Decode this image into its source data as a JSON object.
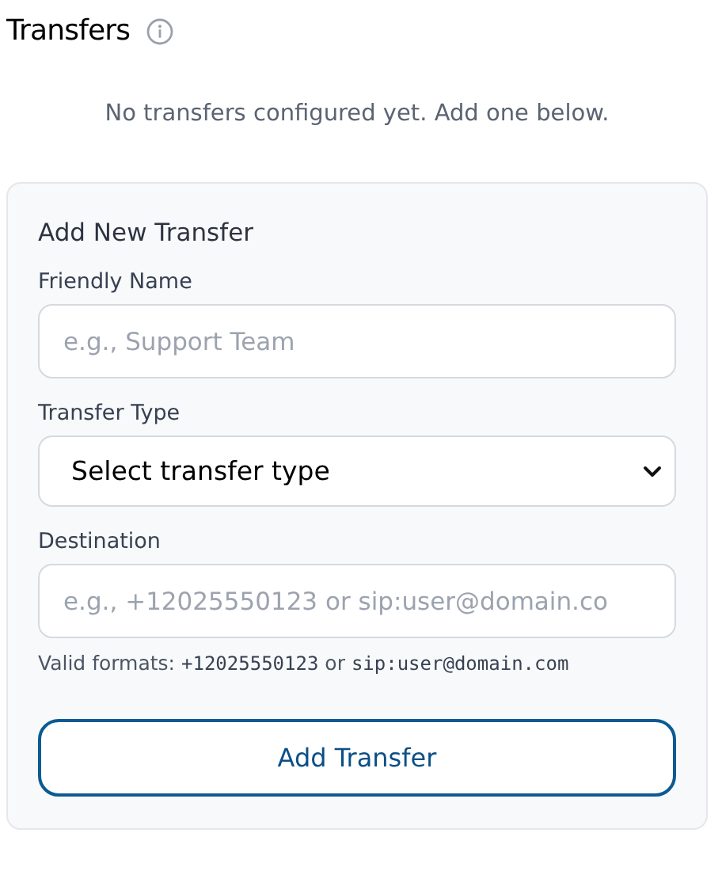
{
  "header": {
    "title": "Transfers"
  },
  "empty_message": "No transfers configured yet. Add one below.",
  "form": {
    "title": "Add New Transfer",
    "fields": [
      {
        "kind": "text",
        "label": "Friendly Name",
        "placeholder": "e.g., Support Team"
      },
      {
        "kind": "select",
        "label": "Transfer Type",
        "value": "Select transfer type"
      },
      {
        "kind": "text",
        "label": "Destination",
        "placeholder": "e.g., +12025550123 or sip:user@domain.co",
        "hint": [
          {
            "kind": "text",
            "text": "Valid formats: "
          },
          {
            "kind": "code",
            "text": "+12025550123"
          },
          {
            "kind": "text",
            "text": " or "
          },
          {
            "kind": "code",
            "text": "sip:user@domain.com"
          }
        ]
      }
    ],
    "submit": "Add Transfer"
  }
}
